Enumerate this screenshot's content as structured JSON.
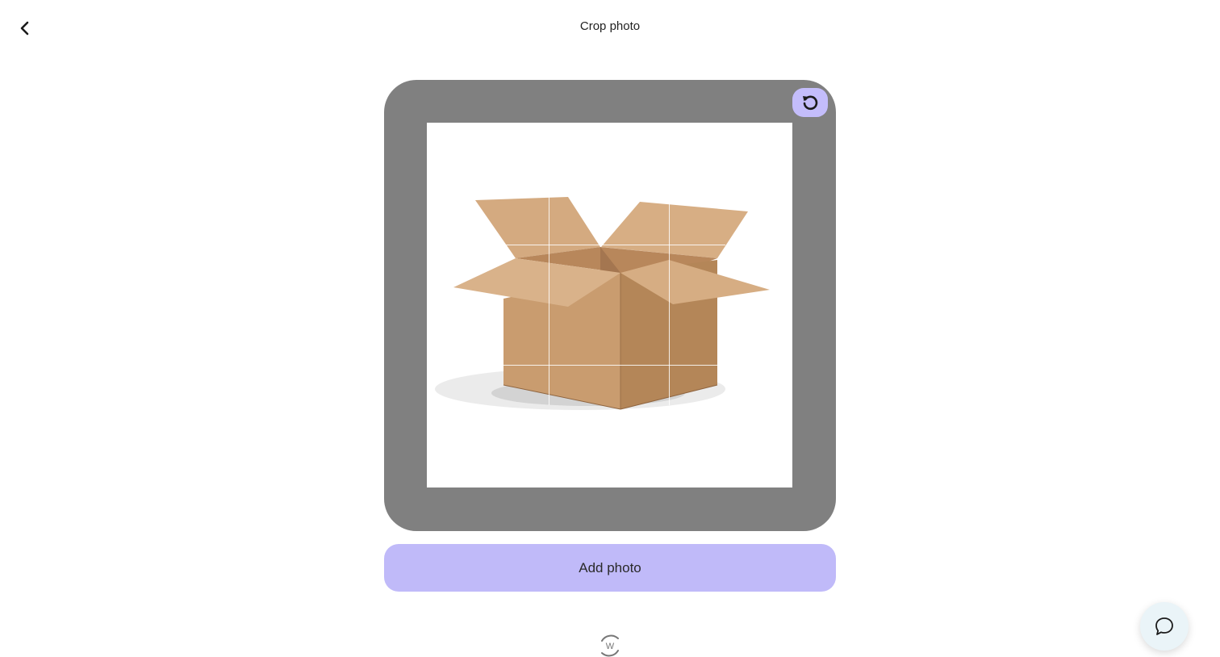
{
  "header": {
    "title": "Crop photo",
    "back_icon": "chevron-left-icon"
  },
  "crop": {
    "reset_icon": "rotate-ccw-icon",
    "image_subject": "open cardboard box",
    "frame_color": "#808080"
  },
  "actions": {
    "add_photo_label": "Add photo",
    "accent_color": "#c0baf9"
  },
  "footer": {
    "logo_icon": "wix-refresh-logo-icon",
    "logo_letter": "W"
  },
  "support": {
    "chat_icon": "chat-bubble-icon"
  }
}
